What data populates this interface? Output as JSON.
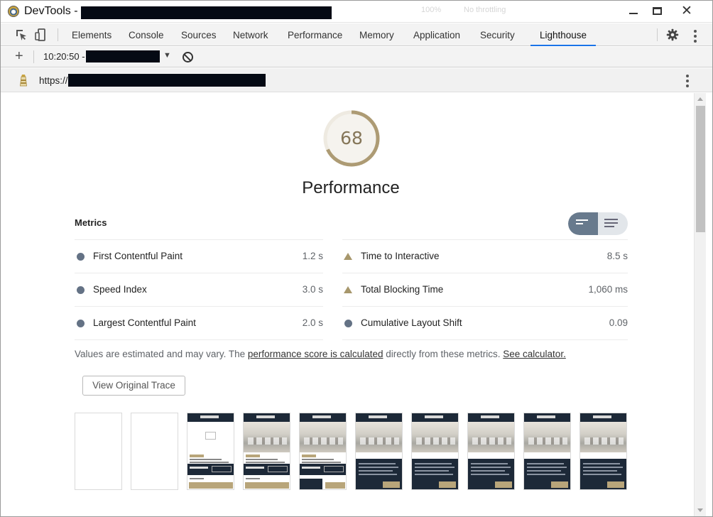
{
  "window": {
    "title": "DevTools -",
    "ghost_menu": [
      "100%",
      "No throttling"
    ],
    "controls": [
      "minimize",
      "maximize",
      "close"
    ]
  },
  "devtools": {
    "tabs": [
      "Elements",
      "Console",
      "Sources",
      "Network",
      "Performance",
      "Memory",
      "Application",
      "Security",
      "Lighthouse"
    ],
    "active_tab": "Lighthouse",
    "icons": [
      "inspect-element-icon",
      "device-toggle-icon",
      "gear-icon",
      "more-vert-icon"
    ]
  },
  "lighthouse_toolbar": {
    "new_report": "+",
    "report_time": "10:20:50 -",
    "dropdown_caret": "▼",
    "clear_icon": "block-icon"
  },
  "url_bar": {
    "url": "https://"
  },
  "report": {
    "score": "68",
    "category": "Performance",
    "score_color": "#857658",
    "metrics_header": "Metrics",
    "metrics": [
      {
        "label": "First Contentful Paint",
        "value": "1.2 s",
        "status": "average",
        "marker": "circle"
      },
      {
        "label": "Speed Index",
        "value": "3.0 s",
        "status": "average",
        "marker": "circle"
      },
      {
        "label": "Largest Contentful Paint",
        "value": "2.0 s",
        "status": "average",
        "marker": "circle"
      },
      {
        "label": "Time to Interactive",
        "value": "8.5 s",
        "status": "fail",
        "marker": "triangle"
      },
      {
        "label": "Total Blocking Time",
        "value": "1,060 ms",
        "status": "fail",
        "marker": "triangle"
      },
      {
        "label": "Cumulative Layout Shift",
        "value": "0.09",
        "status": "average",
        "marker": "circle"
      }
    ],
    "note": {
      "prefix": "Values are estimated and may vary. The ",
      "link1": "performance score is calculated",
      "middle": " directly from these metrics. ",
      "link2": "See calculator."
    },
    "view_trace_label": "View Original Trace",
    "filmstrip_frames": 10,
    "colors": {
      "gray_marker": "#647285",
      "triangle_marker": "#a7976c",
      "toggle_active": "#687a8d"
    }
  }
}
